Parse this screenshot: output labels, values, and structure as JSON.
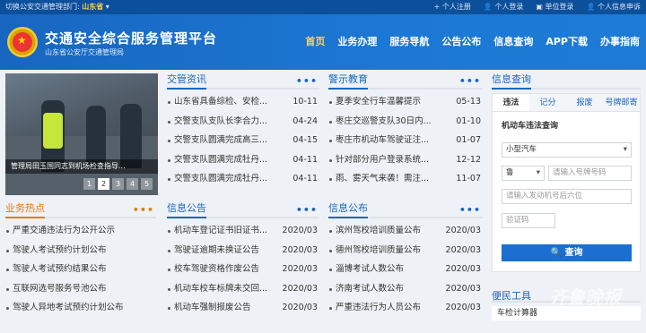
{
  "topbar": {
    "switch_label": "切换公安交通管理部门:",
    "province": "山东省",
    "links": [
      "个人注册",
      "个人登录",
      "单位登录",
      "个人信息申诉"
    ]
  },
  "header": {
    "title": "交通安全综合服务管理平台",
    "subtitle": "山东省公安厅交通管理局",
    "nav": [
      "首页",
      "业务办理",
      "服务导航",
      "公告公布",
      "信息查询",
      "APP下载",
      "办事指南"
    ]
  },
  "slider": {
    "caption": "管理局田玉国同志到机场检查指导...",
    "pages": [
      "1",
      "2",
      "3",
      "4",
      "5"
    ],
    "active_page": "2"
  },
  "news": {
    "title": "交管资讯",
    "more": "•••",
    "items": [
      {
        "text": "山东省具备综检、安检...",
        "date": "10-11"
      },
      {
        "text": "交警支队支队长李合力...",
        "date": "04-24"
      },
      {
        "text": "交警支队圆满完成高三...",
        "date": "04-15"
      },
      {
        "text": "交警支队圆满完成牡丹...",
        "date": "04-11"
      },
      {
        "text": "交警支队圆满完成牡丹...",
        "date": "04-11"
      }
    ]
  },
  "warning": {
    "title": "警示教育",
    "more": "•••",
    "items": [
      {
        "text": "夏季安全行车温馨提示",
        "date": "05-13"
      },
      {
        "text": "枣庄交巡警支队30日内...",
        "date": "01-10"
      },
      {
        "text": "枣庄市机动车驾驶证注...",
        "date": "01-07"
      },
      {
        "text": "针对部分用户登录系统...",
        "date": "12-12"
      },
      {
        "text": "雨、雾天气来袭！需注...",
        "date": "11-07"
      }
    ]
  },
  "hot": {
    "title": "业务热点",
    "more": "•••",
    "items": [
      "严重交通违法行为公开公示",
      "驾驶人考试预约计划公布",
      "驾驶人考试预约结果公布",
      "互联网选号服务号池公布",
      "驾驶人异地考试预约计划公布"
    ]
  },
  "info_notice": {
    "title": "信息公告",
    "more": "•••",
    "items": [
      {
        "text": "机动车登记证书旧证书...",
        "date": "2020/03"
      },
      {
        "text": "驾驶证逾期未换证公告",
        "date": "2020/03"
      },
      {
        "text": "校车驾驶资格作废公告",
        "date": "2020/03"
      },
      {
        "text": "机动车校车标牌未交回...",
        "date": "2020/03"
      },
      {
        "text": "机动车强制报废公告",
        "date": "2020/03"
      }
    ]
  },
  "info_publish": {
    "title": "信息公布",
    "more": "•••",
    "items": [
      {
        "text": "滨州驾校培训质量公布",
        "date": "2020/03"
      },
      {
        "text": "德州驾校培训质量公布",
        "date": "2020/03"
      },
      {
        "text": "淄博考试人数公布",
        "date": "2020/03"
      },
      {
        "text": "济南考试人数公布",
        "date": "2020/03"
      },
      {
        "text": "严重违法行为人员公布",
        "date": "2020/03"
      }
    ]
  },
  "query": {
    "title": "信息查询",
    "tabs": [
      "违法",
      "记分",
      "报废",
      "号牌邮寄"
    ],
    "active_tab": "违法",
    "form_title": "机动车违法查询",
    "vehicle_type": "小型汽车",
    "plate_prefix": "鲁",
    "plate_placeholder": "请输入号牌号码",
    "engine_placeholder": "请输入发动机号后六位",
    "captcha_placeholder": "验证码",
    "submit": "查询"
  },
  "utility": {
    "title": "便民工具",
    "calc": "车检计算器"
  },
  "watermark": {
    "main": "齐鲁晚报",
    "sub": "我在现场·上齐鲁"
  }
}
